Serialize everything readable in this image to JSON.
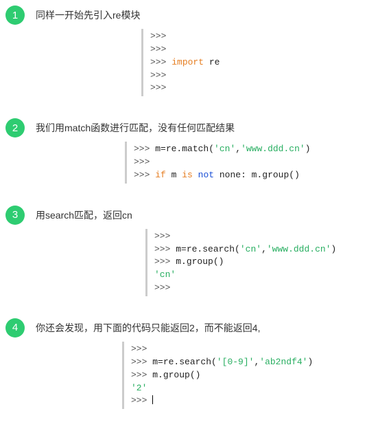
{
  "steps": [
    {
      "num": "1",
      "title": "同样一开始先引入re模块",
      "code_class": "ml-154",
      "lines": [
        [
          {
            "c": "prompt",
            "t": ">>>"
          }
        ],
        [
          {
            "c": "prompt",
            "t": ">>>"
          }
        ],
        [
          {
            "c": "prompt",
            "t": ">>> "
          },
          {
            "c": "kw-orange",
            "t": "import"
          },
          {
            "c": "plain",
            "t": " re"
          }
        ],
        [
          {
            "c": "prompt",
            "t": ">>>"
          }
        ],
        [
          {
            "c": "prompt",
            "t": ">>>"
          }
        ]
      ]
    },
    {
      "num": "2",
      "title": "我们用match函数进行匹配，没有任何匹配结果",
      "code_class": "ml-130",
      "lines": [
        [
          {
            "c": "prompt",
            "t": ">>> "
          },
          {
            "c": "plain",
            "t": "m=re.match("
          },
          {
            "c": "str-green",
            "t": "'cn'"
          },
          {
            "c": "plain",
            "t": ","
          },
          {
            "c": "str-green",
            "t": "'www.ddd.cn'"
          },
          {
            "c": "plain",
            "t": ")"
          }
        ],
        [
          {
            "c": "prompt",
            "t": ">>>"
          }
        ],
        [
          {
            "c": "prompt",
            "t": ">>> "
          },
          {
            "c": "kw-orange",
            "t": "if"
          },
          {
            "c": "plain",
            "t": " m "
          },
          {
            "c": "kw-orange",
            "t": "is"
          },
          {
            "c": "plain",
            "t": " "
          },
          {
            "c": "kw-blue",
            "t": "not"
          },
          {
            "c": "plain",
            "t": " none: m.group()"
          }
        ]
      ]
    },
    {
      "num": "3",
      "title": "用search匹配，返回cn",
      "code_class": "ml-160",
      "lines": [
        [
          {
            "c": "prompt",
            "t": ">>>"
          }
        ],
        [
          {
            "c": "prompt",
            "t": ">>> "
          },
          {
            "c": "plain",
            "t": "m=re.search("
          },
          {
            "c": "str-green",
            "t": "'cn'"
          },
          {
            "c": "plain",
            "t": ","
          },
          {
            "c": "str-green",
            "t": "'www.ddd.cn'"
          },
          {
            "c": "plain",
            "t": ")"
          }
        ],
        [
          {
            "c": "prompt",
            "t": ">>> "
          },
          {
            "c": "plain",
            "t": "m.group()"
          }
        ],
        [
          {
            "c": "str-green",
            "t": "'cn'"
          }
        ],
        [
          {
            "c": "prompt",
            "t": ">>>"
          }
        ]
      ]
    },
    {
      "num": "4",
      "title": "你还会发现，用下面的代码只能返回2，而不能返回4,",
      "code_class": "ml-126",
      "lines": [
        [
          {
            "c": "prompt",
            "t": ">>>"
          }
        ],
        [
          {
            "c": "prompt",
            "t": ">>> "
          },
          {
            "c": "plain",
            "t": "m=re.search("
          },
          {
            "c": "str-green",
            "t": "'[0-9]'"
          },
          {
            "c": "plain",
            "t": ","
          },
          {
            "c": "str-green",
            "t": "'ab2ndf4'"
          },
          {
            "c": "plain",
            "t": ")"
          }
        ],
        [
          {
            "c": "prompt",
            "t": ">>> "
          },
          {
            "c": "plain",
            "t": "m.group()"
          }
        ],
        [
          {
            "c": "str-green",
            "t": "'2'"
          }
        ],
        [
          {
            "c": "prompt",
            "t": ">>> "
          },
          {
            "c": "cursor",
            "t": ""
          }
        ]
      ]
    }
  ]
}
